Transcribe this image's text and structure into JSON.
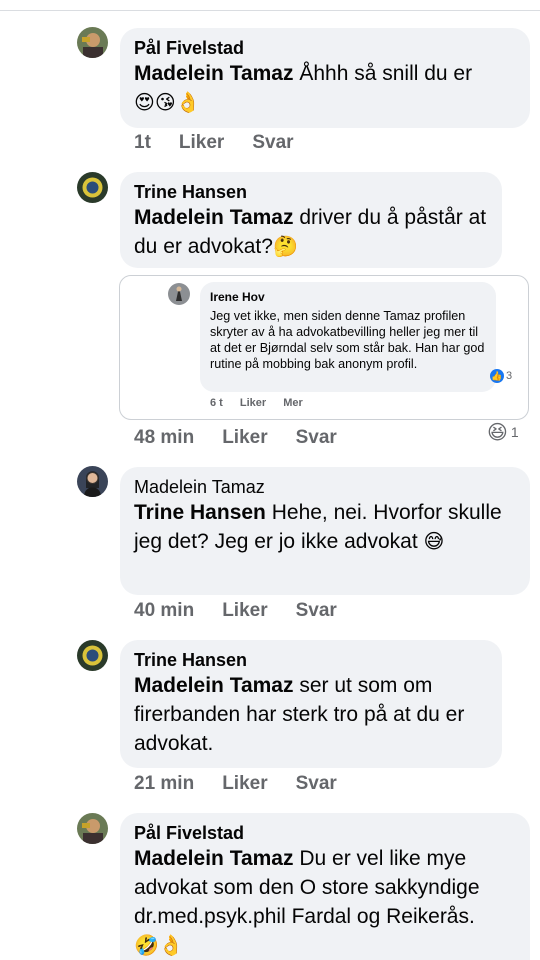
{
  "comments": [
    {
      "author": "Pål Fivelstad",
      "mention": "Madelein Tamaz",
      "text": " Åhhh så snill du er",
      "emoji": "😍😘👌",
      "time": "1t",
      "like": "Liker",
      "reply": "Svar"
    },
    {
      "author": "Trine Hansen",
      "mention": "Madelein Tamaz",
      "text": " driver du å påstår at du er advokat?",
      "emoji": "🤔",
      "time": "48 min",
      "like": "Liker",
      "reply": "Svar",
      "shared": {
        "author": "Irene Hov",
        "text": "Jeg vet ikke, men siden denne Tamaz profilen skryter av å ha advokatbevilling heller jeg mer til at det er Bjørndal selv som står bak. Han har god rutine på mobbing bak anonym profil.",
        "reactions": "3",
        "time": "6 t",
        "like": "Liker",
        "more": "Mer"
      },
      "reaction_emoji": "😆",
      "reaction_count": "1"
    },
    {
      "author": "Madelein Tamaz",
      "mention": "Trine Hansen",
      "text": " Hehe, nei. Hvorfor skulle jeg det? Jeg er jo ikke advokat",
      "emoji": "😅",
      "time": "40 min",
      "like": "Liker",
      "reply": "Svar"
    },
    {
      "author": "Trine Hansen",
      "mention": "Madelein Tamaz",
      "text": " ser ut som om firerbanden har sterk tro på at du er advokat.",
      "emoji": "",
      "time": "21 min",
      "like": "Liker",
      "reply": "Svar"
    },
    {
      "author": "Pål Fivelstad",
      "mention": "Madelein Tamaz",
      "text": " Du er vel like mye advokat som den O store sakkyndige dr.med.psyk.phil Fardal og Reikerås.",
      "emoji": "🤣👌",
      "time": "",
      "like": "",
      "reply": ""
    }
  ],
  "colors": {
    "bubble": "#f0f2f5",
    "meta": "#65676b",
    "like_blue": "#1877f2"
  }
}
